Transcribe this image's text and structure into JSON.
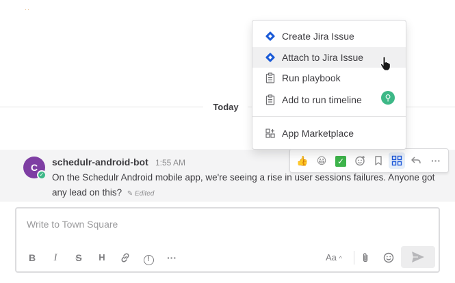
{
  "date_separator": "Today",
  "post": {
    "avatar_initial": "C",
    "username": "schedulr-android-bot",
    "time": "1:55 AM",
    "message": "On the Schedulr Android mobile app, we're seeing a rise in user sessions failures. Anyone got any lead on this?",
    "edited_label": "Edited"
  },
  "reactions": {
    "thumbs_up": "👍",
    "grin": "😀",
    "check": "✓"
  },
  "menu": {
    "items": [
      {
        "label": "Create Jira Issue",
        "icon": "jira-icon"
      },
      {
        "label": "Attach to Jira Issue",
        "icon": "jira-icon",
        "hovered": true
      },
      {
        "label": "Run playbook",
        "icon": "clipboard-icon"
      },
      {
        "label": "Add to run timeline",
        "icon": "clipboard-icon"
      },
      {
        "label": "App Marketplace",
        "icon": "marketplace-icon"
      }
    ]
  },
  "composer": {
    "placeholder": "Write to Town Square",
    "formatting": {
      "bold": "B",
      "italic": "I",
      "strike": "S",
      "heading": "H",
      "text_style": "Aa"
    }
  },
  "colors": {
    "jira_blue": "#1a5ad7",
    "avatar_purple": "#7e3ea3",
    "online_green": "#3db887",
    "active_blue": "#1c58d9"
  }
}
